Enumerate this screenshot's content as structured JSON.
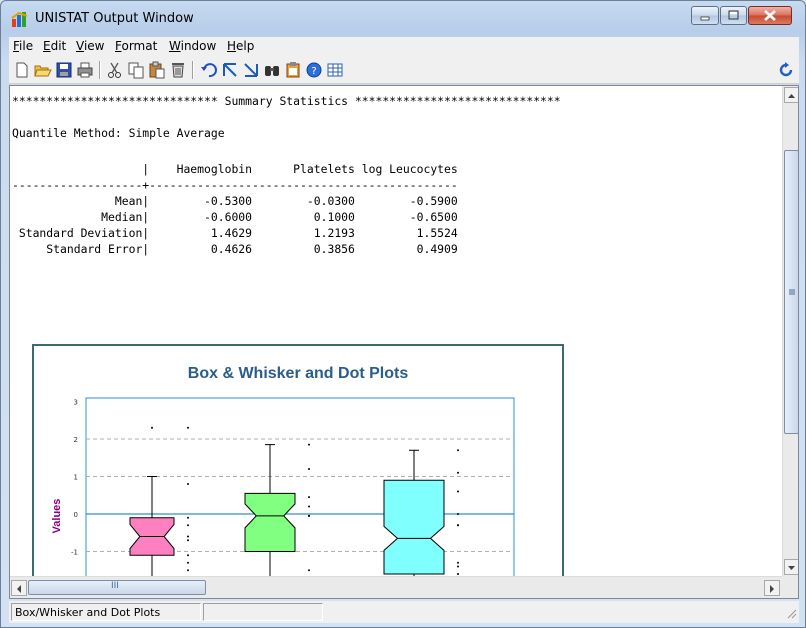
{
  "window": {
    "title": "UNISTAT Output Window"
  },
  "menu": [
    "File",
    "Edit",
    "View",
    "Format",
    "Window",
    "Help"
  ],
  "toolbar": {
    "buttons": [
      "new-icon",
      "open-icon",
      "save-icon",
      "print-icon",
      "cut-icon",
      "copy-icon",
      "paste-icon",
      "delete-icon",
      "undo-icon",
      "goto-start-icon",
      "goto-end-icon",
      "find-icon",
      "clipboard-icon",
      "help-icon",
      "table-icon"
    ],
    "right_icon": "refresh-icon"
  },
  "output": {
    "lines": [
      "****************************** Summary Statistics ******************************",
      "",
      "Quantile Method: Simple Average",
      "",
      "                   |    Haemoglobin      Platelets log Leucocytes",
      "-------------------+---------------------------------------------",
      "               Mean|        -0.5300        -0.0300        -0.5900",
      "             Median|        -0.6000         0.1000        -0.6500",
      " Standard Deviation|         1.4629         1.2193         1.5524",
      "     Standard Error|         0.4626         0.3856         0.4909"
    ]
  },
  "chart_data": {
    "type": "box",
    "title": "Box & Whisker and Dot Plots",
    "ylabel": "Values",
    "ylim_visible": [
      -1.6,
      3
    ],
    "yticks": [
      "3",
      "2",
      "1",
      "0",
      "-1"
    ],
    "series": [
      {
        "color": "#ff80c0",
        "whisker_high": 1.0,
        "q3": -0.1,
        "median": -0.6,
        "q1": -1.1,
        "outlier_high": 2.3,
        "dots": [
          2.3,
          0.8,
          -0.1,
          -0.3,
          -0.6,
          -0.7,
          -1.1,
          -1.3,
          -1.5
        ]
      },
      {
        "color": "#80ff80",
        "whisker_high": 1.85,
        "q3": 0.55,
        "median": -0.05,
        "q1": -1.0,
        "dots": [
          1.85,
          1.2,
          0.45,
          0.2,
          -0.05,
          -0.05,
          -1.5
        ]
      },
      {
        "color": "#80ffff",
        "whisker_high": 1.7,
        "q3": 0.9,
        "median": -0.65,
        "q1": -1.6,
        "dots": [
          1.7,
          1.1,
          0.6,
          0.0,
          -0.3,
          -0.3,
          -1.3,
          -1.4,
          -1.6
        ]
      }
    ]
  },
  "scroll": {
    "h_thumb_label": "III"
  },
  "status": {
    "pane1": "Box/Whisker and Dot Plots",
    "pane2": ""
  },
  "colors": {
    "frame": "#3a6b70",
    "title": "#2a5d8a",
    "ylabel": "#8b008b",
    "plot_border": "#2f8fd8"
  }
}
